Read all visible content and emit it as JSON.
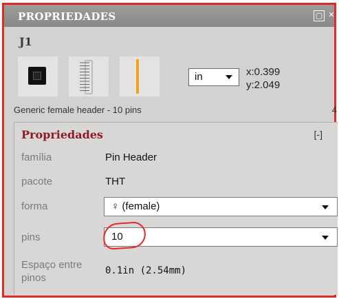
{
  "panel": {
    "title": "PROPRIEDADES",
    "float_icon": "▢",
    "close_icon": "✕"
  },
  "part": {
    "name": "J1",
    "views": [
      "breadboard-view-icon",
      "schematic-view-icon",
      "pcb-view-icon"
    ],
    "unit": "in",
    "x": "x:0.399",
    "y": "y:2.049",
    "description": "Generic female header - 10 pins",
    "description_tail": "4"
  },
  "properties": {
    "heading": "Propriedades",
    "collapse": "[-]",
    "rows": [
      {
        "label": "família",
        "value": "Pin Header"
      },
      {
        "label": "pacote",
        "value": "THT"
      },
      {
        "label": "forma",
        "value": "♀ (female)"
      },
      {
        "label": "pins",
        "value": "10"
      },
      {
        "label": "Espaço entre pinos",
        "value": "0.1in (2.54mm)"
      }
    ]
  },
  "colors": {
    "accent_border": "#e02a2a",
    "heading": "#8a1c24",
    "titlebar": "#8a8b89",
    "pcb_trace": "#f0a21a"
  }
}
